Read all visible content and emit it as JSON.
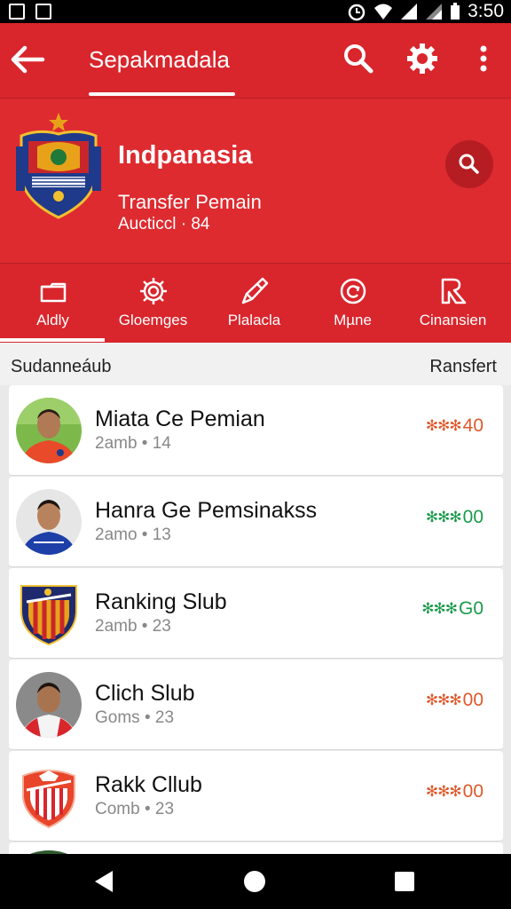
{
  "status_bar": {
    "time": "3:50"
  },
  "app_bar": {
    "title": "Sepakmadala"
  },
  "hero": {
    "team_name": "Indpanasia",
    "subtitle": "Transfer Pemain",
    "detail": "Aucticcl · 84"
  },
  "tabs": [
    {
      "label": "Aldly",
      "icon": "folder-icon"
    },
    {
      "label": "Gloemges",
      "icon": "gear-icon"
    },
    {
      "label": "Plalacla",
      "icon": "pencil-icon"
    },
    {
      "label": "Mµne",
      "icon": "refresh-icon"
    },
    {
      "label": "Cinansien",
      "icon": "ruler-icon"
    }
  ],
  "list_header": {
    "left": "Sudanneáub",
    "right": "Ransfert"
  },
  "rows": [
    {
      "name": "Miata Ce Pemian",
      "meta": "2amb • 14",
      "value": "40",
      "color": "#e0582a",
      "avatar": "player-avatar"
    },
    {
      "name": "Hanra Ge Pemsinakss",
      "meta": "2amo • 13",
      "value": "00",
      "color": "#1a9a4a",
      "avatar": "player-avatar"
    },
    {
      "name": "Ranking Slub",
      "meta": "2amb • 23",
      "value": "G0",
      "color": "#1a9a4a",
      "avatar": "club-crest"
    },
    {
      "name": "Clich Slub",
      "meta": "Goms • 23",
      "value": "00",
      "color": "#e0582a",
      "avatar": "player-avatar"
    },
    {
      "name": "Rakk Cllub",
      "meta": "Comb • 23",
      "value": "00",
      "color": "#e0582a",
      "avatar": "club-crest"
    }
  ],
  "colors": {
    "primary": "#d9252c",
    "hero": "#de2b30"
  }
}
